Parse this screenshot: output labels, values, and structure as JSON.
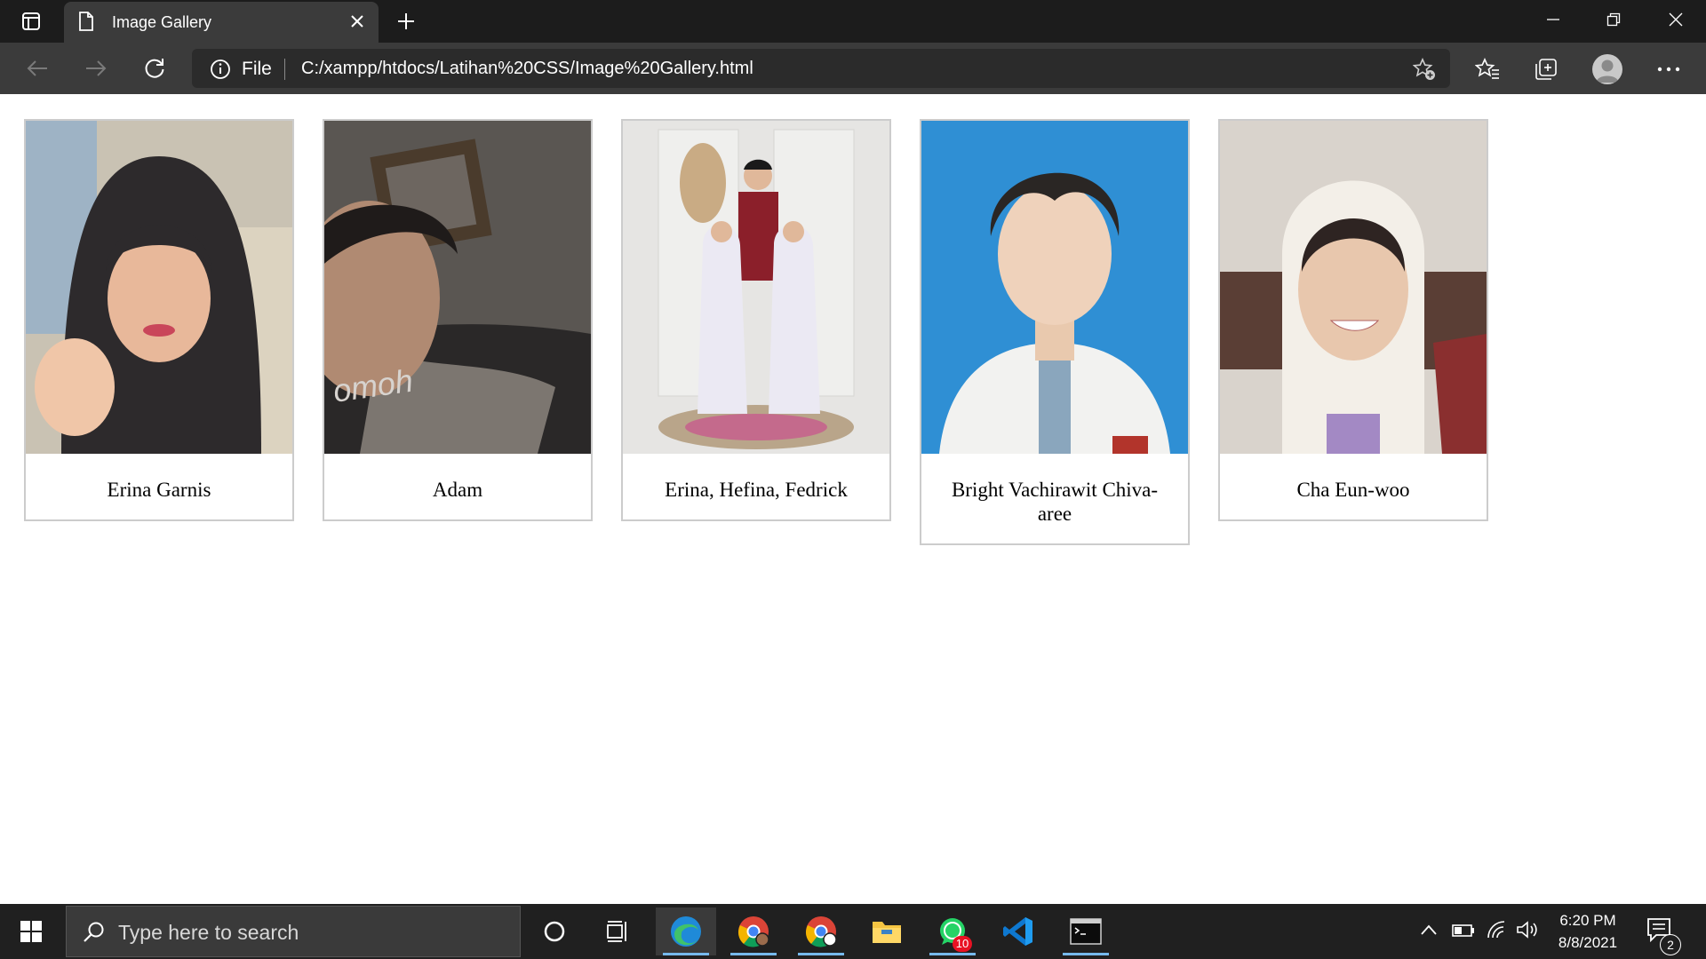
{
  "browser": {
    "tab_title": "Image Gallery",
    "address_scheme": "File",
    "address_url": "C:/xampp/htdocs/Latihan%20CSS/Image%20Gallery.html"
  },
  "gallery": {
    "cards": [
      {
        "caption": "Erina Garnis"
      },
      {
        "caption": "Adam"
      },
      {
        "caption": "Erina, Hefina, Fedrick"
      },
      {
        "caption": "Bright Vachirawit Chiva-aree"
      },
      {
        "caption": "Cha Eun-woo"
      }
    ]
  },
  "taskbar": {
    "search_placeholder": "Type here to search",
    "whatsapp_badge": "10",
    "time": "6:20 PM",
    "date": "8/8/2021",
    "notification_count": "2"
  },
  "colors": {
    "tabbar_bg": "#1c1c1c",
    "toolbar_bg": "#3b3b3b",
    "card_border": "#cccccc",
    "taskbar_bg": "#202020",
    "active_underline": "#76b9ed"
  }
}
